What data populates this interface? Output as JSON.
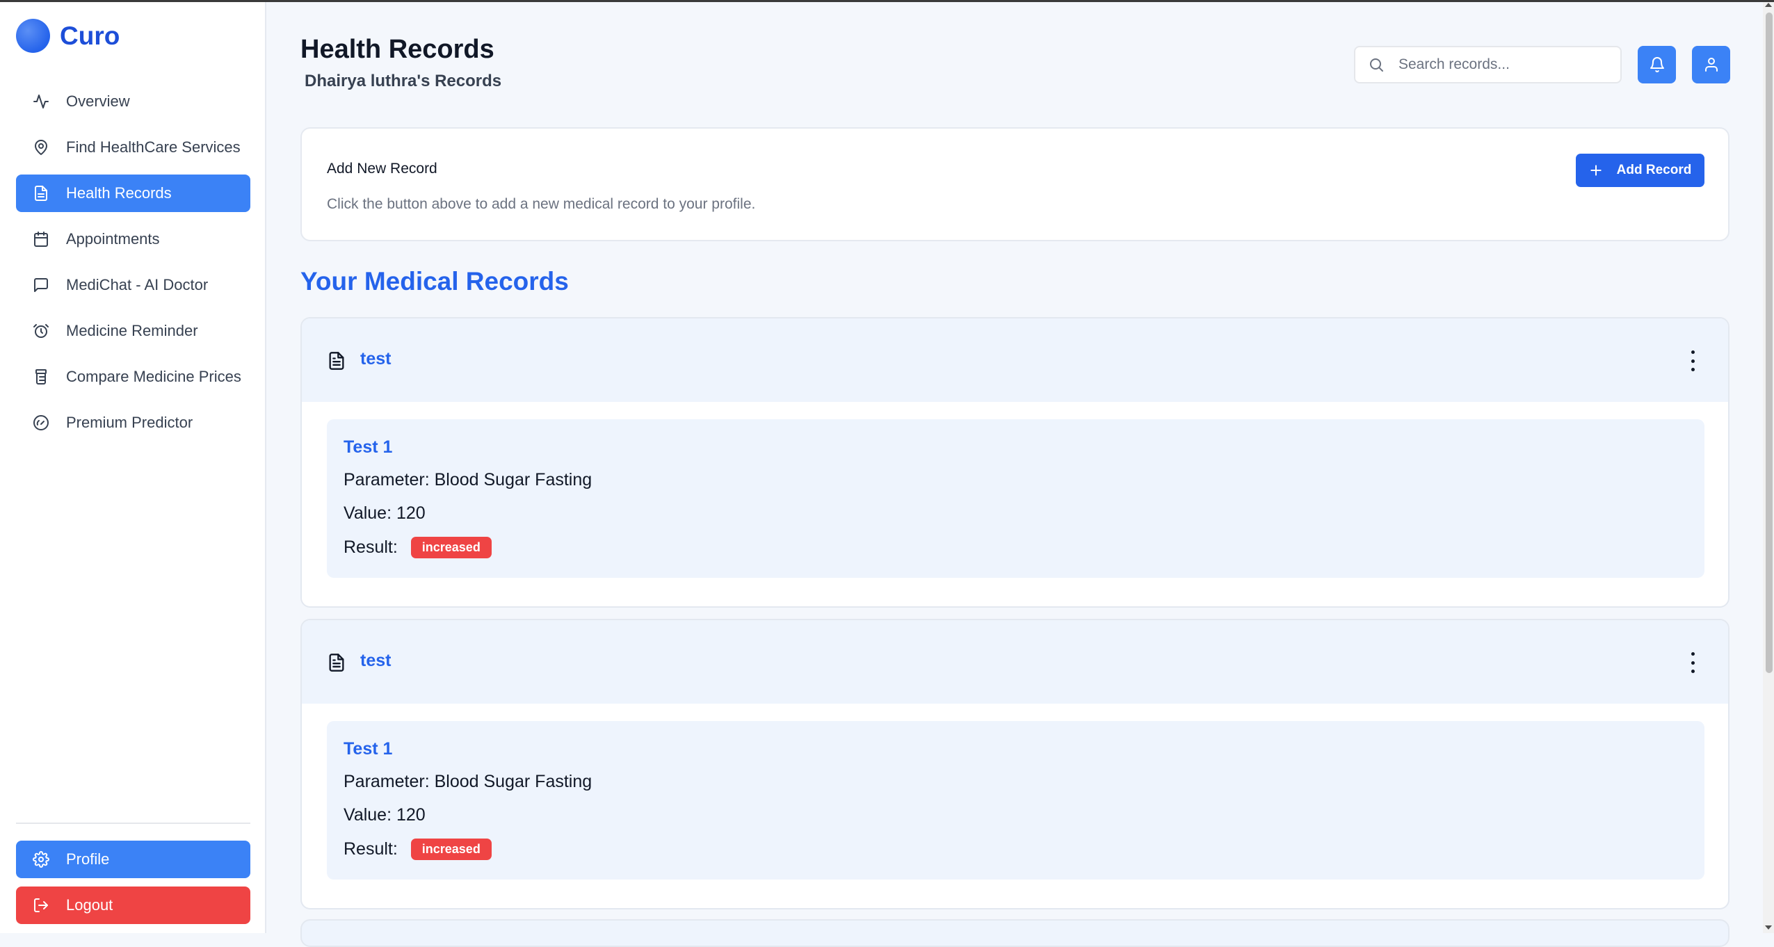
{
  "brand": {
    "name": "Curo"
  },
  "sidebar": {
    "items": [
      {
        "label": "Overview",
        "icon": "activity-icon",
        "active": false
      },
      {
        "label": "Find HealthCare Services",
        "icon": "map-pin-icon",
        "active": false
      },
      {
        "label": "Health Records",
        "icon": "file-text-icon",
        "active": true
      },
      {
        "label": "Appointments",
        "icon": "calendar-icon",
        "active": false
      },
      {
        "label": "MediChat - AI Doctor",
        "icon": "message-square-icon",
        "active": false
      },
      {
        "label": "Medicine Reminder",
        "icon": "alarm-clock-icon",
        "active": false
      },
      {
        "label": "Compare Medicine Prices",
        "icon": "pill-bottle-icon",
        "active": false
      },
      {
        "label": "Premium Predictor",
        "icon": "gauge-icon",
        "active": false
      }
    ],
    "profile_label": "Profile",
    "logout_label": "Logout"
  },
  "header": {
    "title": "Health Records",
    "subtitle": "Dhairya luthra's Records",
    "search_placeholder": "Search records..."
  },
  "add_card": {
    "title": "Add New Record",
    "description": "Click the button above to add a new medical record to your profile.",
    "button_label": "Add Record"
  },
  "section_title": "Your Medical Records",
  "records": [
    {
      "name": "test",
      "test": {
        "name": "Test 1",
        "parameter_label": "Parameter:",
        "parameter": "Blood Sugar Fasting",
        "value_label": "Value:",
        "value": "120",
        "result_label": "Result:",
        "result": "increased"
      }
    },
    {
      "name": "test",
      "test": {
        "name": "Test 1",
        "parameter_label": "Parameter:",
        "parameter": "Blood Sugar Fasting",
        "value_label": "Value:",
        "value": "120",
        "result_label": "Result:",
        "result": "increased"
      }
    }
  ],
  "colors": {
    "primary": "#3b82f6",
    "primary_dark": "#2563eb",
    "danger": "#ef4444",
    "light_panel": "#eef4fd"
  }
}
